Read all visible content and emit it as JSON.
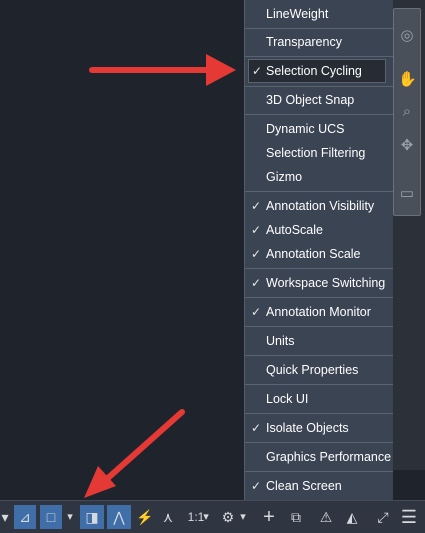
{
  "menu": {
    "items": [
      {
        "label": "LineWeight",
        "checked": false
      },
      {
        "label": "Transparency",
        "checked": false
      },
      {
        "label": "Selection Cycling",
        "checked": true,
        "highlighted": true
      },
      {
        "label": "3D Object Snap",
        "checked": false
      },
      {
        "label": "Dynamic UCS",
        "checked": false
      },
      {
        "label": "Selection Filtering",
        "checked": false
      },
      {
        "label": "Gizmo",
        "checked": false
      },
      {
        "label": "Annotation Visibility",
        "checked": true
      },
      {
        "label": "AutoScale",
        "checked": true
      },
      {
        "label": "Annotation Scale",
        "checked": true
      },
      {
        "label": "Workspace Switching",
        "checked": true
      },
      {
        "label": "Annotation Monitor",
        "checked": true
      },
      {
        "label": "Units",
        "checked": false
      },
      {
        "label": "Quick Properties",
        "checked": false
      },
      {
        "label": "Lock UI",
        "checked": false
      },
      {
        "label": "Isolate Objects",
        "checked": true
      },
      {
        "label": "Graphics Performance",
        "checked": false
      },
      {
        "label": "Clean Screen",
        "checked": true
      }
    ],
    "check_glyph": "✓"
  },
  "statusbar": {
    "scale_label": "1:1",
    "icons": [
      "ortho-icon",
      "isometric-icon",
      "annotation-visibility-icon",
      "autoscale-icon",
      "annotation-scale-icon",
      "gear-icon",
      "plus-icon",
      "quick-properties-icon",
      "isolate-icon",
      "graphics-performance-icon",
      "clean-screen-icon",
      "hamburger-menu-icon"
    ]
  },
  "colors": {
    "menu_bg": "#3b4453",
    "highlight_bg": "#262b34",
    "canvas_bg": "#1f242c",
    "arrow": "#e53935",
    "active_button": "#3f6ea8"
  }
}
